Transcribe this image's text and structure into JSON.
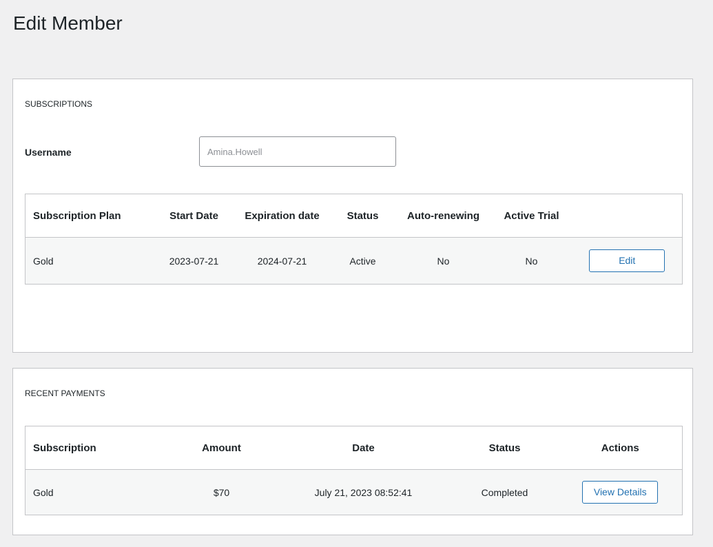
{
  "page": {
    "title": "Edit Member"
  },
  "subscriptions": {
    "section_title": "SUBSCRIPTIONS",
    "username_label": "Username",
    "username_placeholder": "Amina.Howell",
    "columns": [
      "Subscription Plan",
      "Start Date",
      "Expiration date",
      "Status",
      "Auto-renewing",
      "Active Trial",
      ""
    ],
    "rows": [
      {
        "plan": "Gold",
        "start_date": "2023-07-21",
        "expiration_date": "2024-07-21",
        "status": "Active",
        "auto_renewing": "No",
        "active_trial": "No",
        "action_label": "Edit"
      }
    ]
  },
  "payments": {
    "section_title": "RECENT PAYMENTS",
    "columns": [
      "Subscription",
      "Amount",
      "Date",
      "Status",
      "Actions"
    ],
    "rows": [
      {
        "subscription": "Gold",
        "amount": "$70",
        "date": "July 21, 2023 08:52:41",
        "status": "Completed",
        "action_label": "View Details"
      }
    ]
  },
  "colors": {
    "accent": "#2271b1",
    "background": "#f0f0f1",
    "row_background": "#f6f7f7",
    "border": "#c3c4c7"
  }
}
